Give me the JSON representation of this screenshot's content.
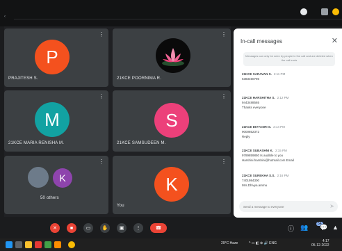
{
  "tiles": [
    {
      "initial": "P",
      "name": "PRAJITESH S.",
      "color": "#f4511e"
    },
    {
      "initial": "",
      "name": "21KCE POORNIMA R.",
      "color": "#000000"
    },
    {
      "initial": "M",
      "name": "21KCE MARIA RENISHA M.",
      "color": "#12a2a2"
    },
    {
      "initial": "S",
      "name": "21KCE SAMSUDEEN M.",
      "color": "#ec407a"
    },
    {
      "initial": "K",
      "name": "50 others",
      "color": "#8e44ad"
    },
    {
      "initial": "K",
      "name": "You",
      "color": "#f4511e"
    }
  ],
  "chat": {
    "title": "In-call messages",
    "notice": "Messages can only be seen by people in the call and are deleted when the call ends",
    "messages": [
      {
        "sender": "21KCE SARAVAN S.",
        "time": "2:11 PM",
        "text": "6383450796"
      },
      {
        "sender": "21KCE HARSHITHA S.",
        "time": "2:12 PM",
        "text": "9443488565",
        "text2": "Thanks everyone"
      },
      {
        "sender": "21KCE DIVYASRI S.",
        "time": "2:14 PM",
        "text": "9000852372",
        "text2": "Reply"
      },
      {
        "sender": "21KCE SUBASHNI K.",
        "time": "2:15 PM",
        "text": "9789859850 Is audible to you",
        "text2": "Harshini.harshini@hotmail.com Email"
      },
      {
        "sender": "21KCE SUREKHA S.S.",
        "time": "2:16 PM",
        "text": "7401984300",
        "text2": "Mrs.Dhivya.ammu"
      }
    ],
    "compose_placeholder": "Send a message to everyone"
  },
  "taskbar": {
    "weather": "29°C Haze",
    "time": "4:17",
    "date": "05-12-2022"
  },
  "controls": {
    "people_count": "54"
  }
}
